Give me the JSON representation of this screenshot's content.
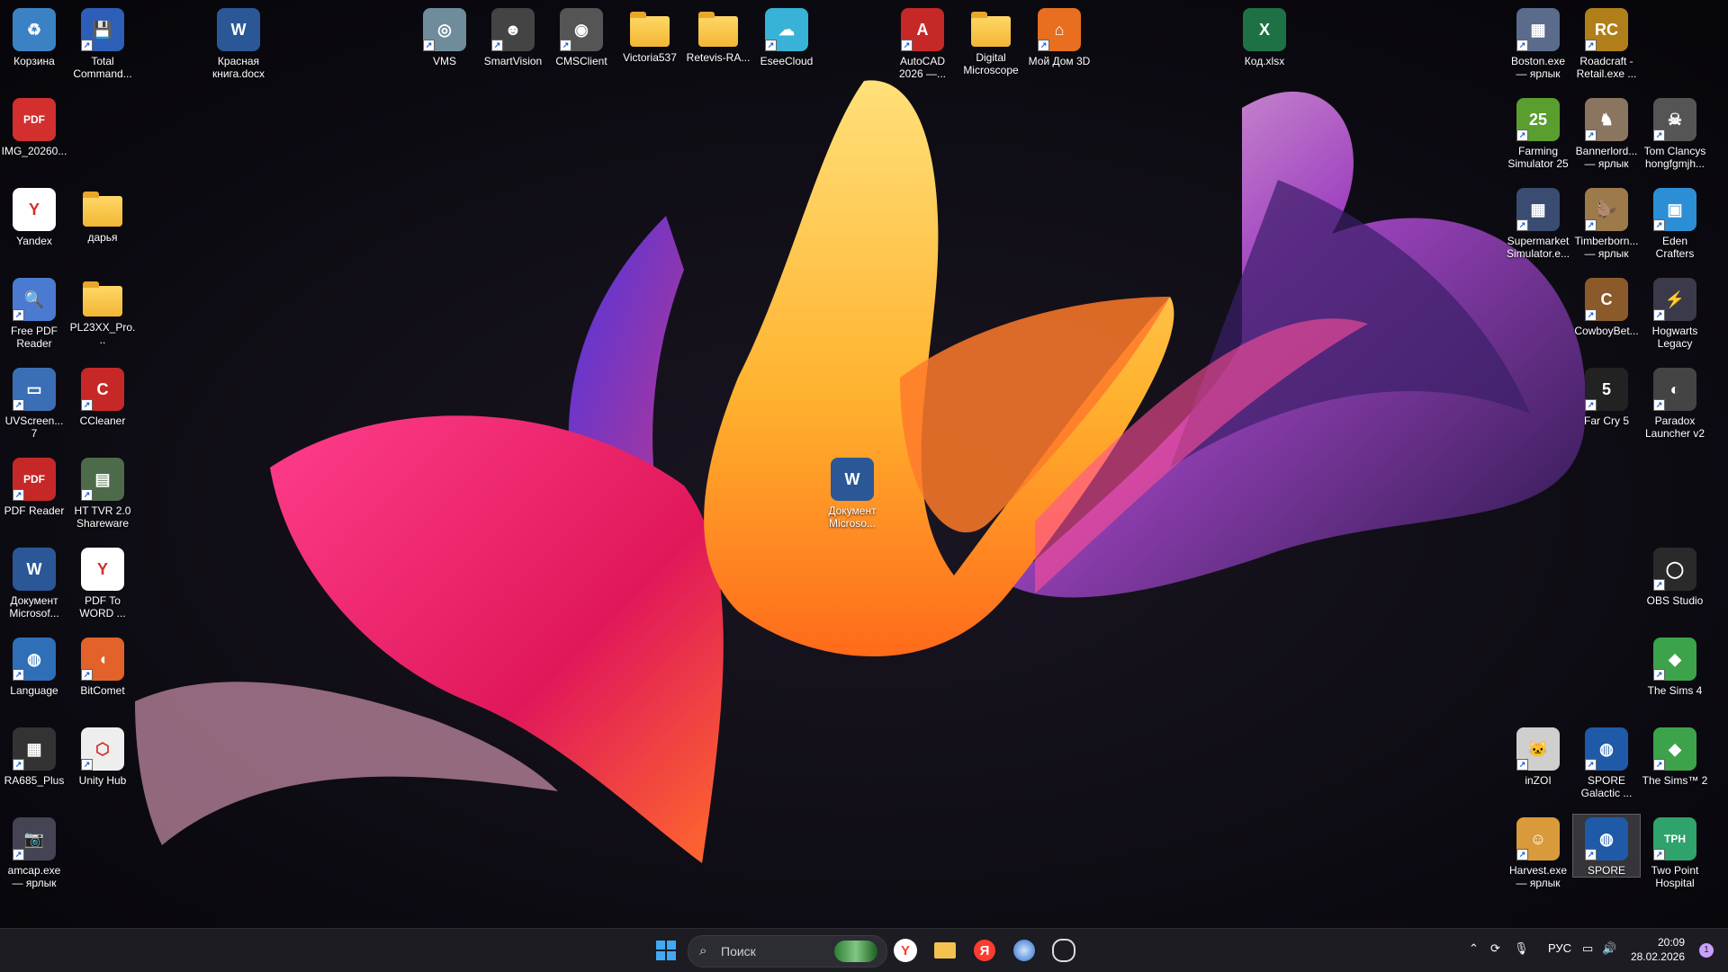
{
  "desktop": {
    "icons": [
      {
        "label": "Корзина",
        "glyph": "♻",
        "color": "#3b82c4",
        "kind": "recycle-bin-icon",
        "shortcut": false
      },
      {
        "label": "Total Command...",
        "glyph": "💾",
        "color": "#2d5fb8",
        "kind": "total-commander-icon",
        "shortcut": true
      },
      {
        "label": "Красная книга.docx",
        "glyph": "W",
        "color": "#2b5797",
        "kind": "word-doc-icon",
        "shortcut": false
      },
      {
        "label": "VMS",
        "glyph": "◎",
        "color": "#6f8c9c",
        "kind": "vms-app-icon",
        "shortcut": true
      },
      {
        "label": "SmartVision",
        "glyph": "☻",
        "color": "#444",
        "kind": "smartvision-app-icon",
        "shortcut": true
      },
      {
        "label": "CMSClient",
        "glyph": "◉",
        "color": "#555",
        "kind": "camera-client-icon",
        "shortcut": true
      },
      {
        "label": "Victoria537",
        "glyph": "",
        "color": "",
        "kind": "folder-icon",
        "shortcut": false
      },
      {
        "label": "Retevis-RA...",
        "glyph": "",
        "color": "",
        "kind": "folder-icon",
        "shortcut": false
      },
      {
        "label": "EseeCloud",
        "glyph": "☁",
        "color": "#38b2d6",
        "kind": "cloud-app-icon",
        "shortcut": true
      },
      {
        "label": "AutoCAD 2026 —...",
        "glyph": "A",
        "color": "#c62828",
        "kind": "autocad-icon",
        "shortcut": true
      },
      {
        "label": "Digital Microscope",
        "glyph": "",
        "color": "",
        "kind": "folder-icon",
        "shortcut": false
      },
      {
        "label": "Мой Дом 3D",
        "glyph": "⌂",
        "color": "#e76f1f",
        "kind": "house-app-icon",
        "shortcut": true
      },
      {
        "label": "Код.xlsx",
        "glyph": "X",
        "color": "#1e7145",
        "kind": "excel-doc-icon",
        "shortcut": false
      },
      {
        "label": "Boston.exe — ярлык",
        "glyph": "▦",
        "color": "#5a6b8c",
        "kind": "boston-game-icon",
        "shortcut": true
      },
      {
        "label": "Roadcraft - Retail.exe ...",
        "glyph": "RC",
        "color": "#b07f1a",
        "kind": "roadcraft-game-icon",
        "shortcut": true
      },
      {
        "label": "IMG_20260...",
        "glyph": "PDF",
        "color": "#d32f2f",
        "kind": "pdf-file-icon",
        "shortcut": false
      },
      {
        "label": "Farming Simulator 25",
        "glyph": "25",
        "color": "#5a9e2f",
        "kind": "farming-sim-icon",
        "shortcut": true
      },
      {
        "label": "Bannerlord... — ярлык",
        "glyph": "♞",
        "color": "#8a7560",
        "kind": "bannerlord-game-icon",
        "shortcut": true
      },
      {
        "label": "Tom Clancys hongfgmjh...",
        "glyph": "☠",
        "color": "#555",
        "kind": "tom-clancy-game-icon",
        "shortcut": true
      },
      {
        "label": "Yandex",
        "glyph": "Y",
        "color": "#fff",
        "kind": "yandex-browser-icon",
        "shortcut": false
      },
      {
        "label": "дарья",
        "glyph": "",
        "color": "",
        "kind": "folder-icon",
        "shortcut": false
      },
      {
        "label": "Supermarket Simulator.e...",
        "glyph": "▦",
        "color": "#3b4c72",
        "kind": "supermarket-sim-icon",
        "shortcut": true
      },
      {
        "label": "Timberborn... — ярлык",
        "glyph": "🦫",
        "color": "#9c7a4a",
        "kind": "timberborn-game-icon",
        "shortcut": true
      },
      {
        "label": "Eden Crafters",
        "glyph": "▣",
        "color": "#2c8fd6",
        "kind": "eden-crafters-icon",
        "shortcut": true
      },
      {
        "label": "Free PDF Reader",
        "glyph": "🔍",
        "color": "#4a7bd1",
        "kind": "pdf-reader-icon",
        "shortcut": true
      },
      {
        "label": "PL23XX_Pro...",
        "glyph": "",
        "color": "",
        "kind": "folder-icon",
        "shortcut": false
      },
      {
        "label": "CowboyBet...",
        "glyph": "C",
        "color": "#8b5a2b",
        "kind": "cowboy-game-icon",
        "shortcut": true
      },
      {
        "label": "Hogwarts Legacy",
        "glyph": "⚡",
        "color": "#3a3a4a",
        "kind": "hogwarts-game-icon",
        "shortcut": true
      },
      {
        "label": "UVScreen... 7",
        "glyph": "▭",
        "color": "#3b6fb5",
        "kind": "uvscreen-app-icon",
        "shortcut": true
      },
      {
        "label": "CCleaner",
        "glyph": "C",
        "color": "#c62828",
        "kind": "ccleaner-icon",
        "shortcut": true
      },
      {
        "label": "Far Cry 5",
        "glyph": "5",
        "color": "#222",
        "kind": "far-cry-game-icon",
        "shortcut": true
      },
      {
        "label": "Paradox Launcher v2",
        "glyph": "◐",
        "color": "#444",
        "kind": "paradox-launcher-icon",
        "shortcut": true
      },
      {
        "label": "PDF Reader",
        "glyph": "PDF",
        "color": "#c62828",
        "kind": "pdf-reader-icon",
        "shortcut": true
      },
      {
        "label": "HT TVR 2.0 Shareware",
        "glyph": "▤",
        "color": "#4d6b4a",
        "kind": "tvr-app-icon",
        "shortcut": true
      },
      {
        "label": "Документ Microso...",
        "glyph": "W",
        "color": "#2b5797",
        "kind": "word-doc-icon",
        "shortcut": false
      },
      {
        "label": "OBS Studio",
        "glyph": "◯",
        "color": "#2a2a2a",
        "kind": "obs-studio-icon",
        "shortcut": true
      },
      {
        "label": "Документ Microsof...",
        "glyph": "W",
        "color": "#2b5797",
        "kind": "word-doc-icon",
        "shortcut": false
      },
      {
        "label": "PDF To WORD ...",
        "glyph": "Y",
        "color": "#fff",
        "kind": "html-file-icon",
        "shortcut": false
      },
      {
        "label": "Language",
        "glyph": "◍",
        "color": "#2e6fb7",
        "kind": "language-app-icon",
        "shortcut": true
      },
      {
        "label": "BitComet",
        "glyph": "◖",
        "color": "#e2622a",
        "kind": "bitcomet-icon",
        "shortcut": true
      },
      {
        "label": "The Sims 4",
        "glyph": "◆",
        "color": "#3ca34a",
        "kind": "sims4-icon",
        "shortcut": true
      },
      {
        "label": "RA685_Plus",
        "glyph": "▦",
        "color": "#333",
        "kind": "ra685-app-icon",
        "shortcut": true
      },
      {
        "label": "Unity Hub",
        "glyph": "⬡",
        "color": "#eee",
        "kind": "unity-hub-icon",
        "shortcut": true
      },
      {
        "label": "inZOI",
        "glyph": "🐱",
        "color": "#cfcfcf",
        "kind": "inzoi-game-icon",
        "shortcut": true
      },
      {
        "label": "SPORE Galactic ...",
        "glyph": "◍",
        "color": "#1e5aa8",
        "kind": "spore-galactic-icon",
        "shortcut": true
      },
      {
        "label": "The Sims™ 2",
        "glyph": "◆",
        "color": "#3ca34a",
        "kind": "sims2-icon",
        "shortcut": true
      },
      {
        "label": "amcap.exe — ярлык",
        "glyph": "📷",
        "color": "#445",
        "kind": "camera-app-icon",
        "shortcut": true
      },
      {
        "label": "Harvest.exe — ярлык",
        "glyph": "☺",
        "color": "#d89a3a",
        "kind": "harvest-game-icon",
        "shortcut": true
      },
      {
        "label": "SPORE",
        "glyph": "◍",
        "color": "#1e5aa8",
        "kind": "spore-icon",
        "shortcut": true
      },
      {
        "label": "Two Point Hospital",
        "glyph": "TPH",
        "color": "#2fa36b",
        "kind": "two-point-hospital-icon",
        "shortcut": true
      }
    ]
  },
  "taskbar": {
    "search_placeholder": "Поиск",
    "apps": [
      {
        "name": "windows-start-icon",
        "glyph": "⊞",
        "color": "#3fa9f5"
      },
      {
        "name": "yandex-browser-taskbar-icon",
        "glyph": "Y",
        "color": "#ff3b30"
      },
      {
        "name": "file-explorer-taskbar-icon",
        "glyph": "▬",
        "color": "#f2c14e"
      },
      {
        "name": "yandex-taskbar-icon",
        "glyph": "Я",
        "color": "#ff3b30"
      },
      {
        "name": "spore-taskbar-icon",
        "glyph": "◍",
        "color": "#4a8fe0"
      },
      {
        "name": "obs-taskbar-icon",
        "glyph": "◯",
        "color": "#ddd"
      }
    ],
    "tray": {
      "language": "РУС",
      "time": "20:09",
      "date": "28.02.2026",
      "notifications": "1"
    }
  }
}
